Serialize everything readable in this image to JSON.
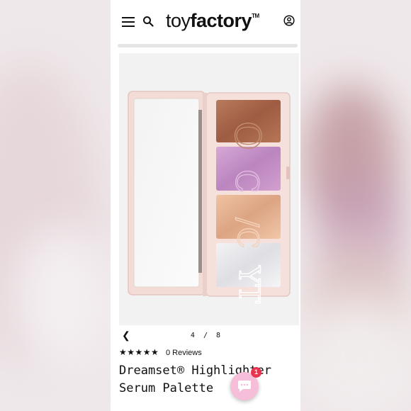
{
  "header": {
    "logo_light": "toy",
    "logo_bold": "factory",
    "logo_trademark": "TM",
    "menu_icon": "hamburger-menu-icon",
    "search_icon": "search-icon",
    "account_icon": "user-account-icon"
  },
  "gallery": {
    "image_subject": "Dreamset Highlighter Serum Palette",
    "pager": {
      "current": "4",
      "separator": "/",
      "total": "8",
      "prev_icon": "chevron-left-icon"
    }
  },
  "product": {
    "rating": 5,
    "stars": "★★★★★",
    "reviews_label": "0 Reviews",
    "title": "Dreamset® Highlighter Serum Palette"
  },
  "chat": {
    "icon": "chat-bubble-icon",
    "badge_count": "1"
  },
  "colors": {
    "accent_chat": "#f6bed8",
    "badge": "#e8344e",
    "palette_case": "#f4dfdc",
    "shade_bronze": "#a96a4f",
    "shade_lilac": "#c591c4",
    "shade_peach": "#e8b595",
    "shade_pearl": "#e9e9ec"
  }
}
